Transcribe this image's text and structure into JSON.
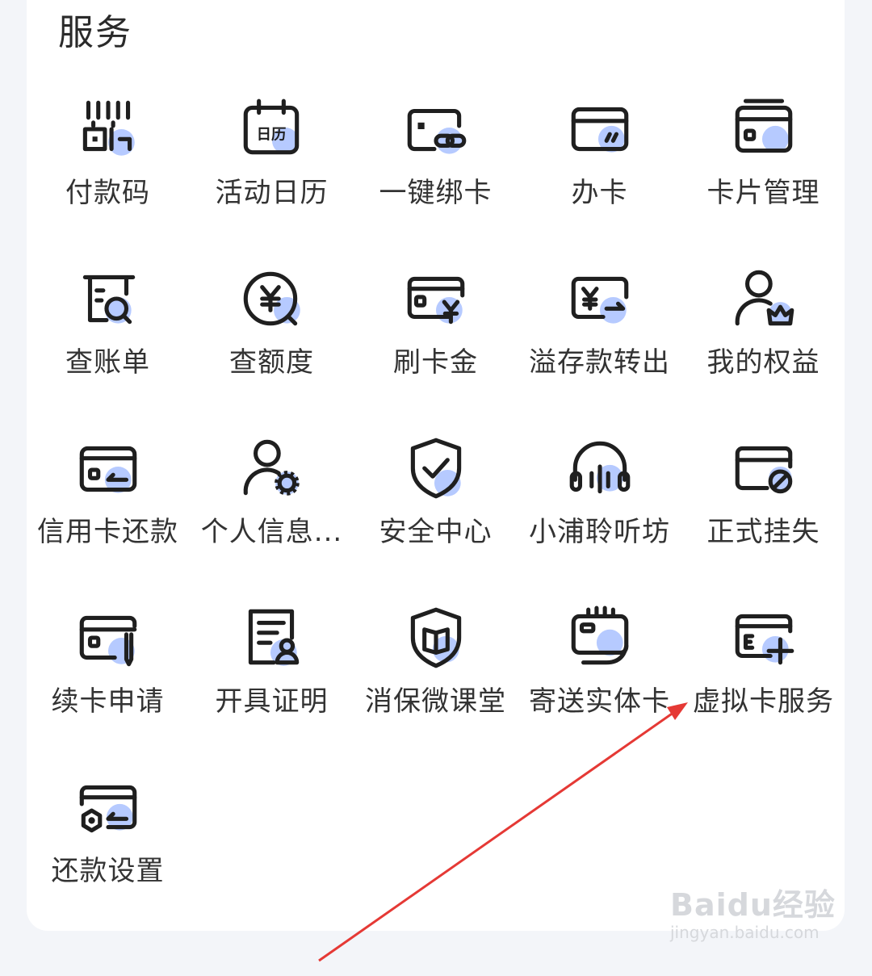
{
  "section": {
    "title": "服务"
  },
  "services": [
    {
      "label": "付款码",
      "icon": "barcode-qr-icon"
    },
    {
      "label": "活动日历",
      "icon": "calendar-icon"
    },
    {
      "label": "一键绑卡",
      "icon": "card-link-icon"
    },
    {
      "label": "办卡",
      "icon": "card-apply-icon"
    },
    {
      "label": "卡片管理",
      "icon": "card-stack-icon"
    },
    {
      "label": "查账单",
      "icon": "bill-search-icon"
    },
    {
      "label": "查额度",
      "icon": "yen-search-icon"
    },
    {
      "label": "刷卡金",
      "icon": "card-yen-icon"
    },
    {
      "label": "溢存款转出",
      "icon": "yen-transfer-icon"
    },
    {
      "label": "我的权益",
      "icon": "user-crown-icon"
    },
    {
      "label": "信用卡还款",
      "icon": "card-repay-icon"
    },
    {
      "label": "个人信息...",
      "icon": "user-gear-icon"
    },
    {
      "label": "安全中心",
      "icon": "shield-check-icon"
    },
    {
      "label": "小浦聆听坊",
      "icon": "headphones-icon"
    },
    {
      "label": "正式挂失",
      "icon": "card-block-icon"
    },
    {
      "label": "续卡申请",
      "icon": "card-pen-icon"
    },
    {
      "label": "开具证明",
      "icon": "document-user-icon"
    },
    {
      "label": "消保微课堂",
      "icon": "shield-book-icon"
    },
    {
      "label": "寄送实体卡",
      "icon": "card-hand-icon"
    },
    {
      "label": "虚拟卡服务",
      "icon": "card-plus-icon"
    },
    {
      "label": "还款设置",
      "icon": "card-setting-icon"
    }
  ],
  "watermark": {
    "brand": "Baidu经验",
    "url": "jingyan.baidu.com"
  },
  "colors": {
    "icon_stroke": "#1f1f1f",
    "icon_accent": "#a9c1ff",
    "arrow": "#e53935",
    "background": "#f3f5f9",
    "card": "#ffffff"
  }
}
